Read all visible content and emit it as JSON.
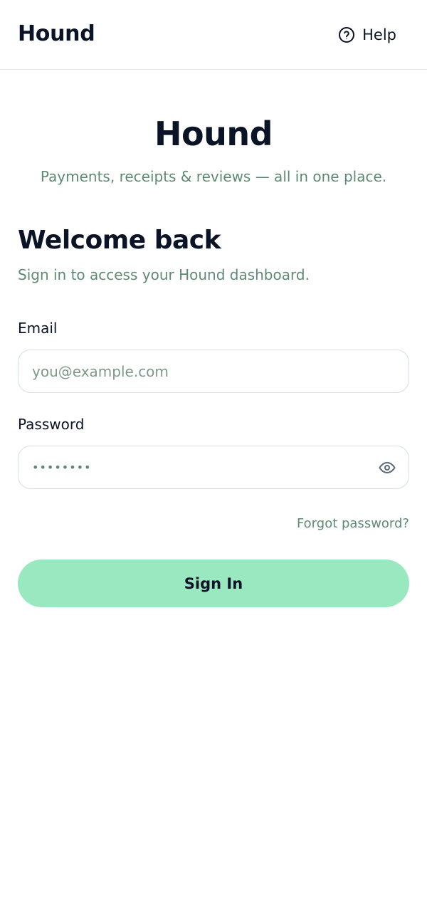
{
  "topbar": {
    "brand": "Hound",
    "help_label": "Help",
    "help_icon": "question-circle-icon"
  },
  "hero": {
    "title": "Hound",
    "subtitle": "Payments, receipts & reviews — all in one place."
  },
  "welcome": {
    "title": "Welcome back",
    "subtitle": "Sign in to access your Hound dashboard."
  },
  "form": {
    "email": {
      "label": "Email",
      "placeholder": "you@example.com",
      "value": ""
    },
    "password": {
      "label": "Password",
      "value": "••••••••",
      "toggle_icon": "eye-icon"
    },
    "forgot_label": "Forgot password?",
    "submit_label": "Sign In"
  },
  "colors": {
    "primary_text": "#0b1326",
    "muted_green": "#5f8a72",
    "button_bg": "#9ae8c0",
    "border": "#d6e0e6"
  }
}
